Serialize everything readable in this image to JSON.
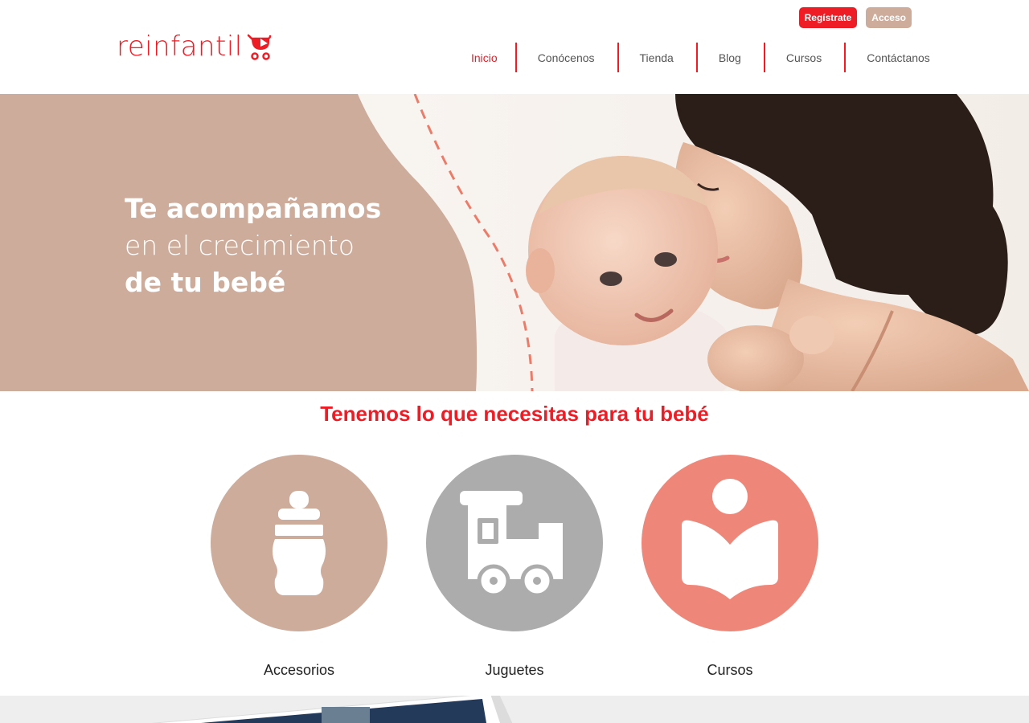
{
  "brand": {
    "name": "reinfantil",
    "color": "#ee1c25",
    "icon": "baby-stroller-icon"
  },
  "top_buttons": {
    "register": "Regístrate",
    "login": "Acceso"
  },
  "nav": [
    {
      "label": "Inicio",
      "active": true
    },
    {
      "label": "Conócenos",
      "active": false
    },
    {
      "label": "Tienda",
      "active": false
    },
    {
      "label": "Blog",
      "active": false
    },
    {
      "label": "Cursos",
      "active": false
    },
    {
      "label": "Contáctanos",
      "active": false
    }
  ],
  "hero": {
    "line1": "Te acompañamos",
    "line2": "en el crecimiento",
    "line3": "de tu bebé",
    "panel_color": "#cdac9c"
  },
  "section": {
    "title": "Tenemos lo que necesitas para tu bebé"
  },
  "categories": [
    {
      "label": "Accesorios",
      "icon": "baby-bottle-icon",
      "color": "#cdac9c"
    },
    {
      "label": "Juguetes",
      "icon": "toy-train-icon",
      "color": "#acacac"
    },
    {
      "label": "Cursos",
      "icon": "reading-person-icon",
      "color": "#ee877a"
    }
  ]
}
